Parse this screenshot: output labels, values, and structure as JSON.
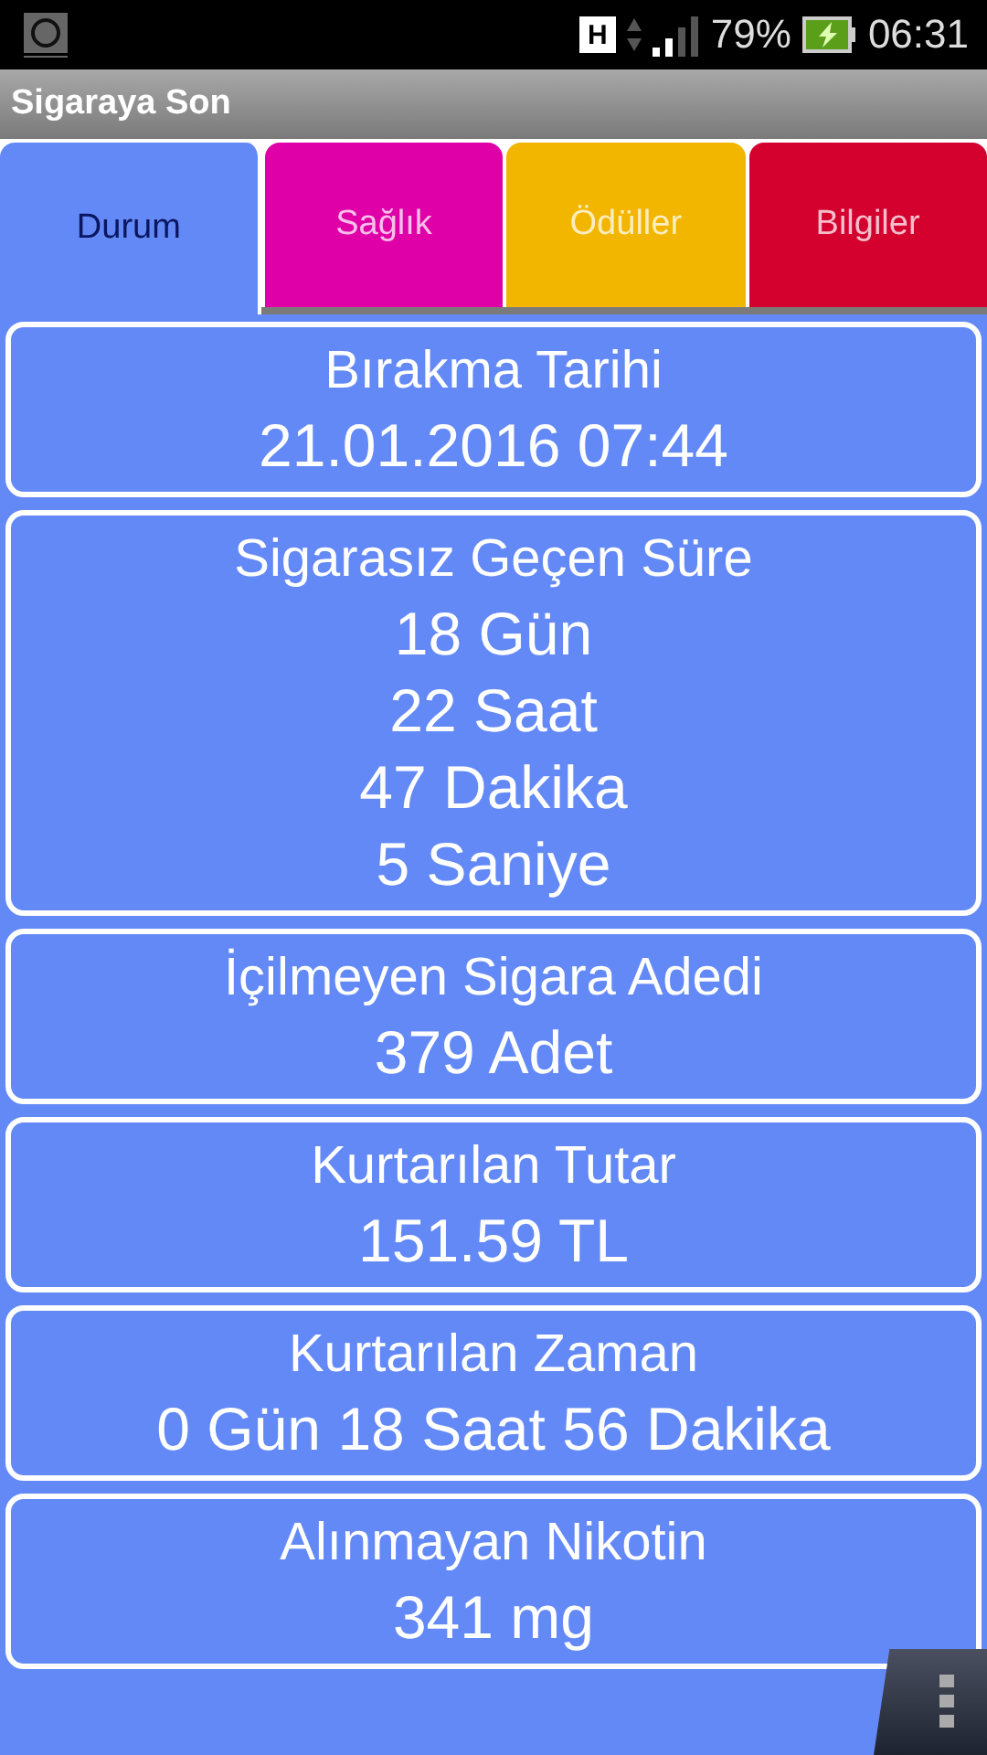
{
  "status_bar": {
    "signal_type": "H",
    "battery": "79%",
    "time": "06:31"
  },
  "app_bar": {
    "title": "Sigaraya Son"
  },
  "tabs": [
    {
      "label": "Durum",
      "selected": true,
      "color": "#6389f7"
    },
    {
      "label": "Sağlık",
      "selected": false,
      "color": "#e000a8"
    },
    {
      "label": "Ödüller",
      "selected": false,
      "color": "#f2b500"
    },
    {
      "label": "Bilgiler",
      "selected": false,
      "color": "#d4002e"
    }
  ],
  "cards": [
    {
      "title": "Bırakma Tarihi",
      "values": [
        "21.01.2016 07:44"
      ]
    },
    {
      "title": "Sigarasız Geçen Süre",
      "values": [
        "18 Gün",
        "22 Saat",
        "47 Dakika",
        "5 Saniye"
      ]
    },
    {
      "title": "İçilmeyen Sigara Adedi",
      "values": [
        "379 Adet"
      ]
    },
    {
      "title": "Kurtarılan Tutar",
      "values": [
        "151.59 TL"
      ]
    },
    {
      "title": "Kurtarılan Zaman",
      "values": [
        "0 Gün 18 Saat 56 Dakika"
      ]
    },
    {
      "title": "Alınmayan Nikotin",
      "values": [
        "341 mg"
      ]
    }
  ]
}
